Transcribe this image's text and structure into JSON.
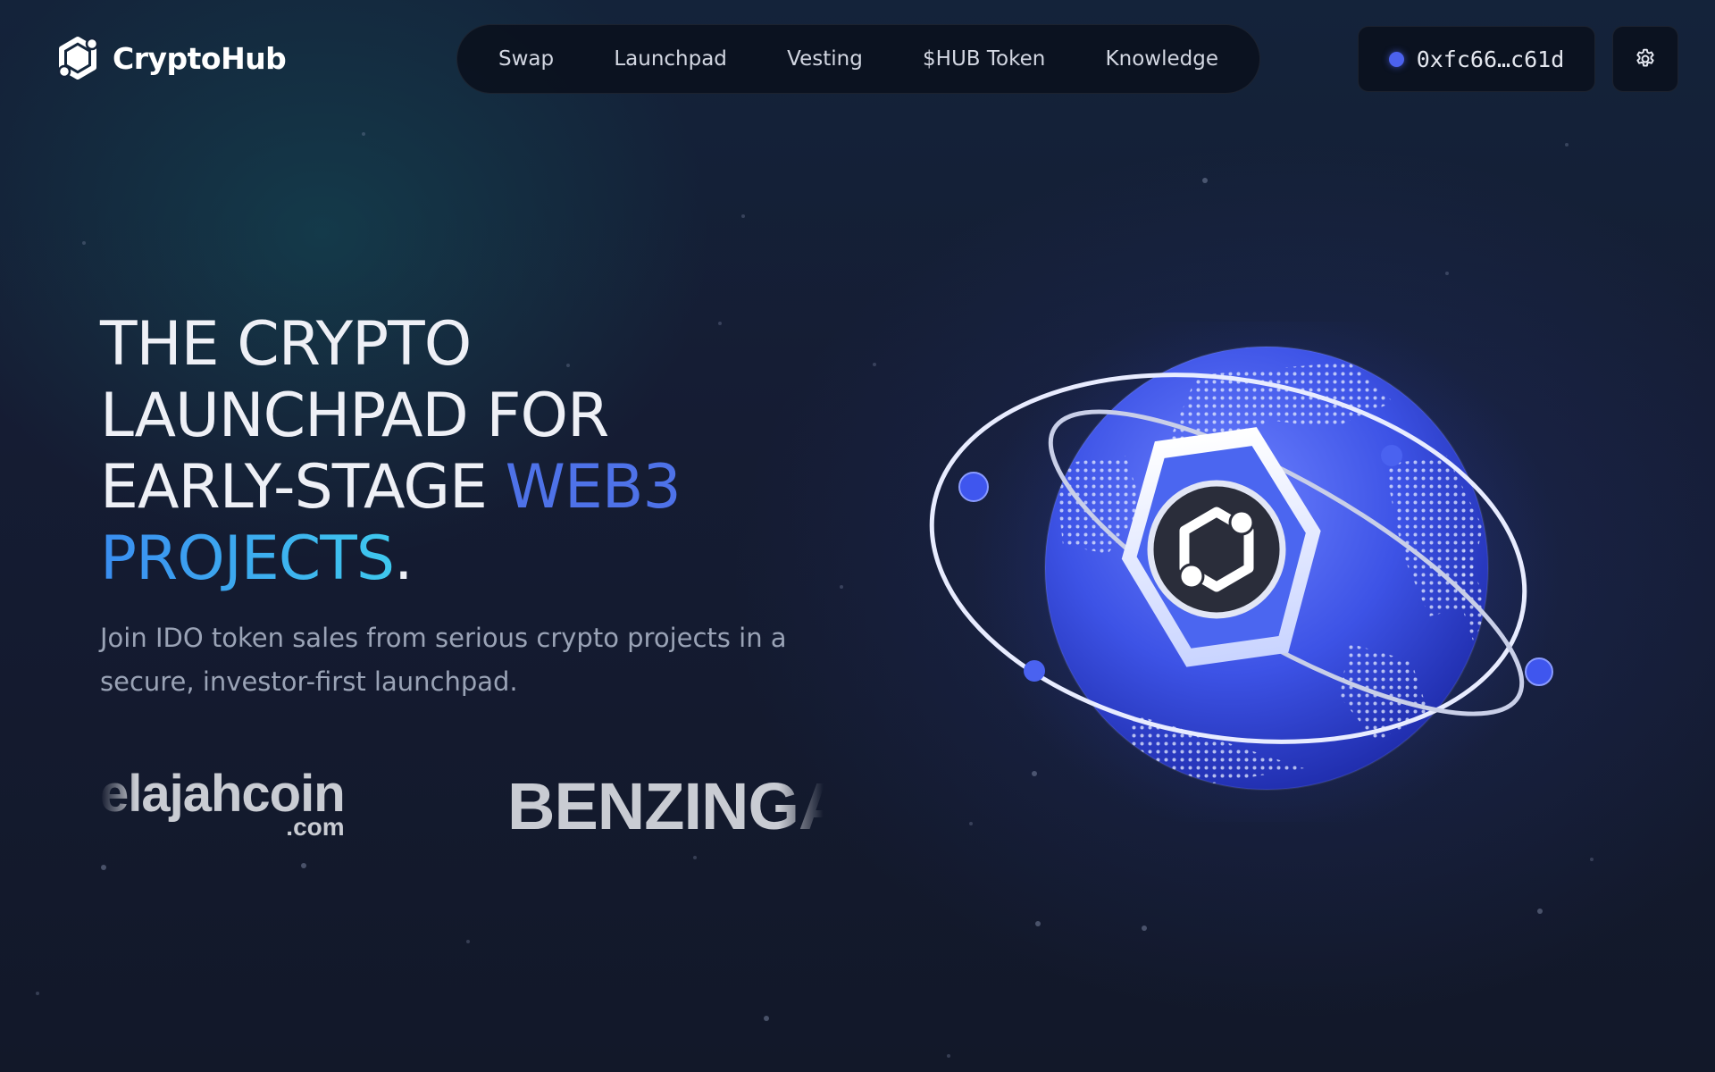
{
  "brand": {
    "name": "CryptoHub",
    "logo_icon": "cryptohub-hexagon-logo"
  },
  "nav": {
    "items": [
      {
        "label": "Swap"
      },
      {
        "label": "Launchpad"
      },
      {
        "label": "Vesting"
      },
      {
        "label": "$HUB Token"
      },
      {
        "label": "Knowledge"
      }
    ]
  },
  "wallet": {
    "address": "0xfc66…c61d",
    "status_color": "#4c62ee"
  },
  "settings": {
    "icon": "gear-icon"
  },
  "hero": {
    "title_line1": "THE CRYPTO",
    "title_line2": "LAUNCHPAD FOR",
    "title_line3_plain": "EARLY-STAGE ",
    "title_line3_accent": "WEB3",
    "title_line4_accent": "PROJECTS",
    "title_period": ".",
    "subtitle": "Join IDO token sales from serious crypto projects in a secure, investor-first launchpad.",
    "accent_color": "#4e72e8"
  },
  "partners": [
    {
      "name": "elajahcoin",
      "suffix": ".com"
    },
    {
      "name": "BENZINGA"
    }
  ],
  "illustration": {
    "icon": "globe-icon"
  }
}
